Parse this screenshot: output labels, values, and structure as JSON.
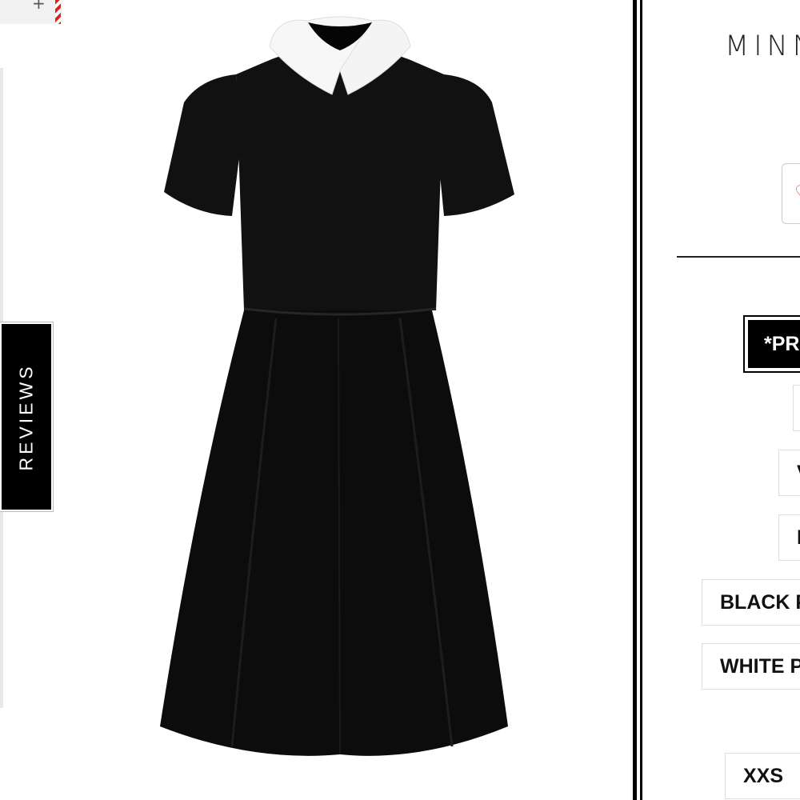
{
  "product": {
    "title": "MINN"
  },
  "reviews_tab": {
    "label": "REVIEWS"
  },
  "colors": {
    "accent": "#000000",
    "heart": "#e34b4b",
    "border": "#dddddd"
  },
  "options": {
    "style_options": [
      {
        "label": "*PR",
        "selected": true
      },
      {
        "label": "",
        "selected": false
      },
      {
        "label": "V",
        "selected": false
      },
      {
        "label": "I",
        "selected": false
      },
      {
        "label": "BLACK P",
        "selected": false
      },
      {
        "label": "WHITE P",
        "selected": false
      }
    ],
    "size_options": [
      {
        "label": "XXS",
        "selected": false
      }
    ]
  },
  "icons": {
    "wishlist": "heart-icon",
    "gallery_expand": "plus-icon"
  }
}
